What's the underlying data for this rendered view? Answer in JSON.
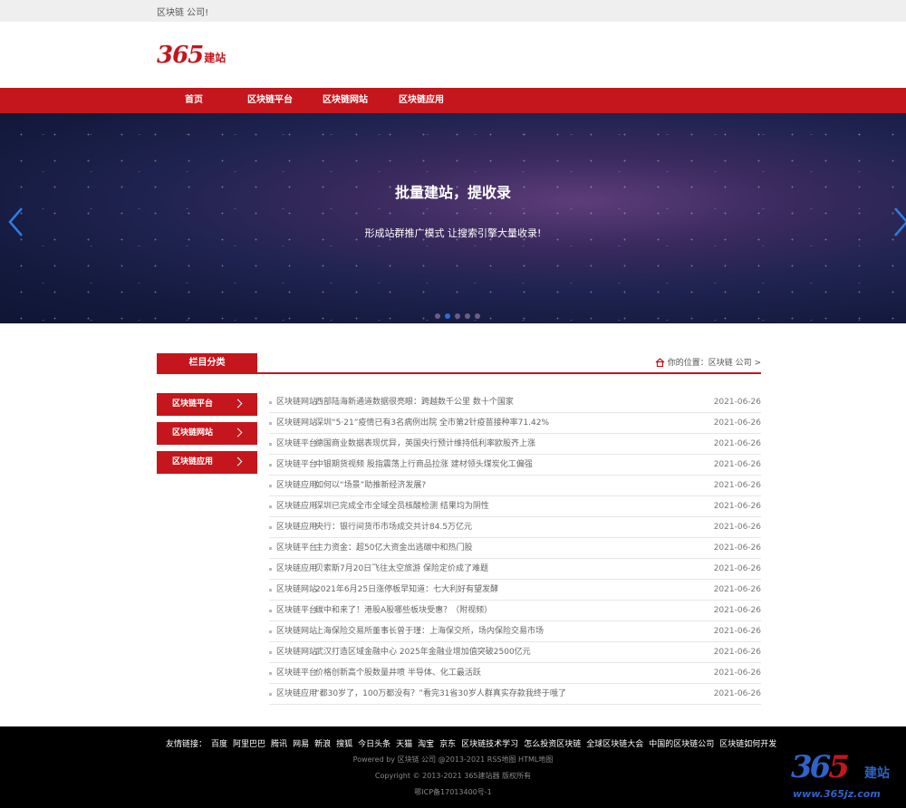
{
  "topbar": {
    "welcome": "区块链 公司!"
  },
  "logo": {
    "num": "365",
    "text": "建站"
  },
  "nav": {
    "items": [
      "首页",
      "区块链平台",
      "区块链网站",
      "区块链应用"
    ]
  },
  "banner": {
    "title": "批量建站，提收录",
    "subtitle": "形成站群推广模式 让搜索引擎大量收录!",
    "slide_count": 5,
    "active_slide": 2
  },
  "category": {
    "tab_label": "栏目分类",
    "breadcrumb": "你的位置：区块链 公司 >"
  },
  "sidebar": {
    "items": [
      {
        "label": "区块链平台"
      },
      {
        "label": "区块链网站"
      },
      {
        "label": "区块链应用"
      }
    ]
  },
  "news": [
    {
      "cat": "区块链网站",
      "title": "西部陆海新通道数据很亮眼：跨越数千公里 数十个国家",
      "date": "2021-06-26"
    },
    {
      "cat": "区块链网站",
      "title": "深圳“5·21”疫情已有3名病例出院 全市第2针疫苗接种率71.42%",
      "date": "2021-06-26"
    },
    {
      "cat": "区块链平台",
      "title": "德国商业数据表现优异，英国央行预计维持低利率欧股齐上涨",
      "date": "2021-06-26"
    },
    {
      "cat": "区块链平台",
      "title": "中银期货视频 股指震荡上行商品拉涨 建材领头煤炭化工偏强",
      "date": "2021-06-26"
    },
    {
      "cat": "区块链应用",
      "title": "如何以“场景”助推新经济发展?",
      "date": "2021-06-26"
    },
    {
      "cat": "区块链应用",
      "title": "深圳已完成全市全域全员核酸检测 结果均为阴性",
      "date": "2021-06-26"
    },
    {
      "cat": "区块链应用",
      "title": "央行：银行间货币市场成交共计84.5万亿元",
      "date": "2021-06-26"
    },
    {
      "cat": "区块链平台",
      "title": "主力资金：超50亿大资金出逃碳中和热门股",
      "date": "2021-06-26"
    },
    {
      "cat": "区块链应用",
      "title": "贝索斯7月20日飞往太空旅游 保险定价成了难题",
      "date": "2021-06-26"
    },
    {
      "cat": "区块链网站",
      "title": "2021年6月25日涨停板早知道：七大利好有望发酵",
      "date": "2021-06-26"
    },
    {
      "cat": "区块链平台",
      "title": "碳中和来了！港股A股哪些板块受惠？（附视频）",
      "date": "2021-06-26"
    },
    {
      "cat": "区块链网站",
      "title": "上海保险交易所董事长曾于瑾：上海保交所，场内保险交易市场",
      "date": "2021-06-26"
    },
    {
      "cat": "区块链网站",
      "title": "武汉打造区域金融中心 2025年金融业增加值突破2500亿元",
      "date": "2021-06-26"
    },
    {
      "cat": "区块链平台",
      "title": "价格创新高个股数量井喷 半导体、化工最活跃",
      "date": "2021-06-26"
    },
    {
      "cat": "区块链应用",
      "title": "“都30岁了，100万都没有？”看完31省30岁人群真实存款我终于哦了",
      "date": "2021-06-26"
    }
  ],
  "footer": {
    "links_label": "友情链接：",
    "links": [
      "百度",
      "阿里巴巴",
      "腾讯",
      "网易",
      "新浪",
      "搜狐",
      "今日头条",
      "天猫",
      "淘宝",
      "京东",
      "区块链技术学习",
      "怎么投资区块链",
      "全球区块链大会",
      "中国的区块链公司",
      "区块链如何开发"
    ],
    "powered": "Powered by 区块链 公司 @2013-2021 RSS地图 HTML地图",
    "copyright": "Copyright © 2013-2021 365建站器 版权所有",
    "icp": "鄂ICP备17013400号-1"
  },
  "corner_logo": {
    "num_a": "36",
    "num_b": "5",
    "text": "建站",
    "url": "www.365jz.com"
  },
  "colors": {
    "brand_red": "#c4161c",
    "footer_bg": "#000000",
    "corner_blue": "#2e63c8"
  }
}
